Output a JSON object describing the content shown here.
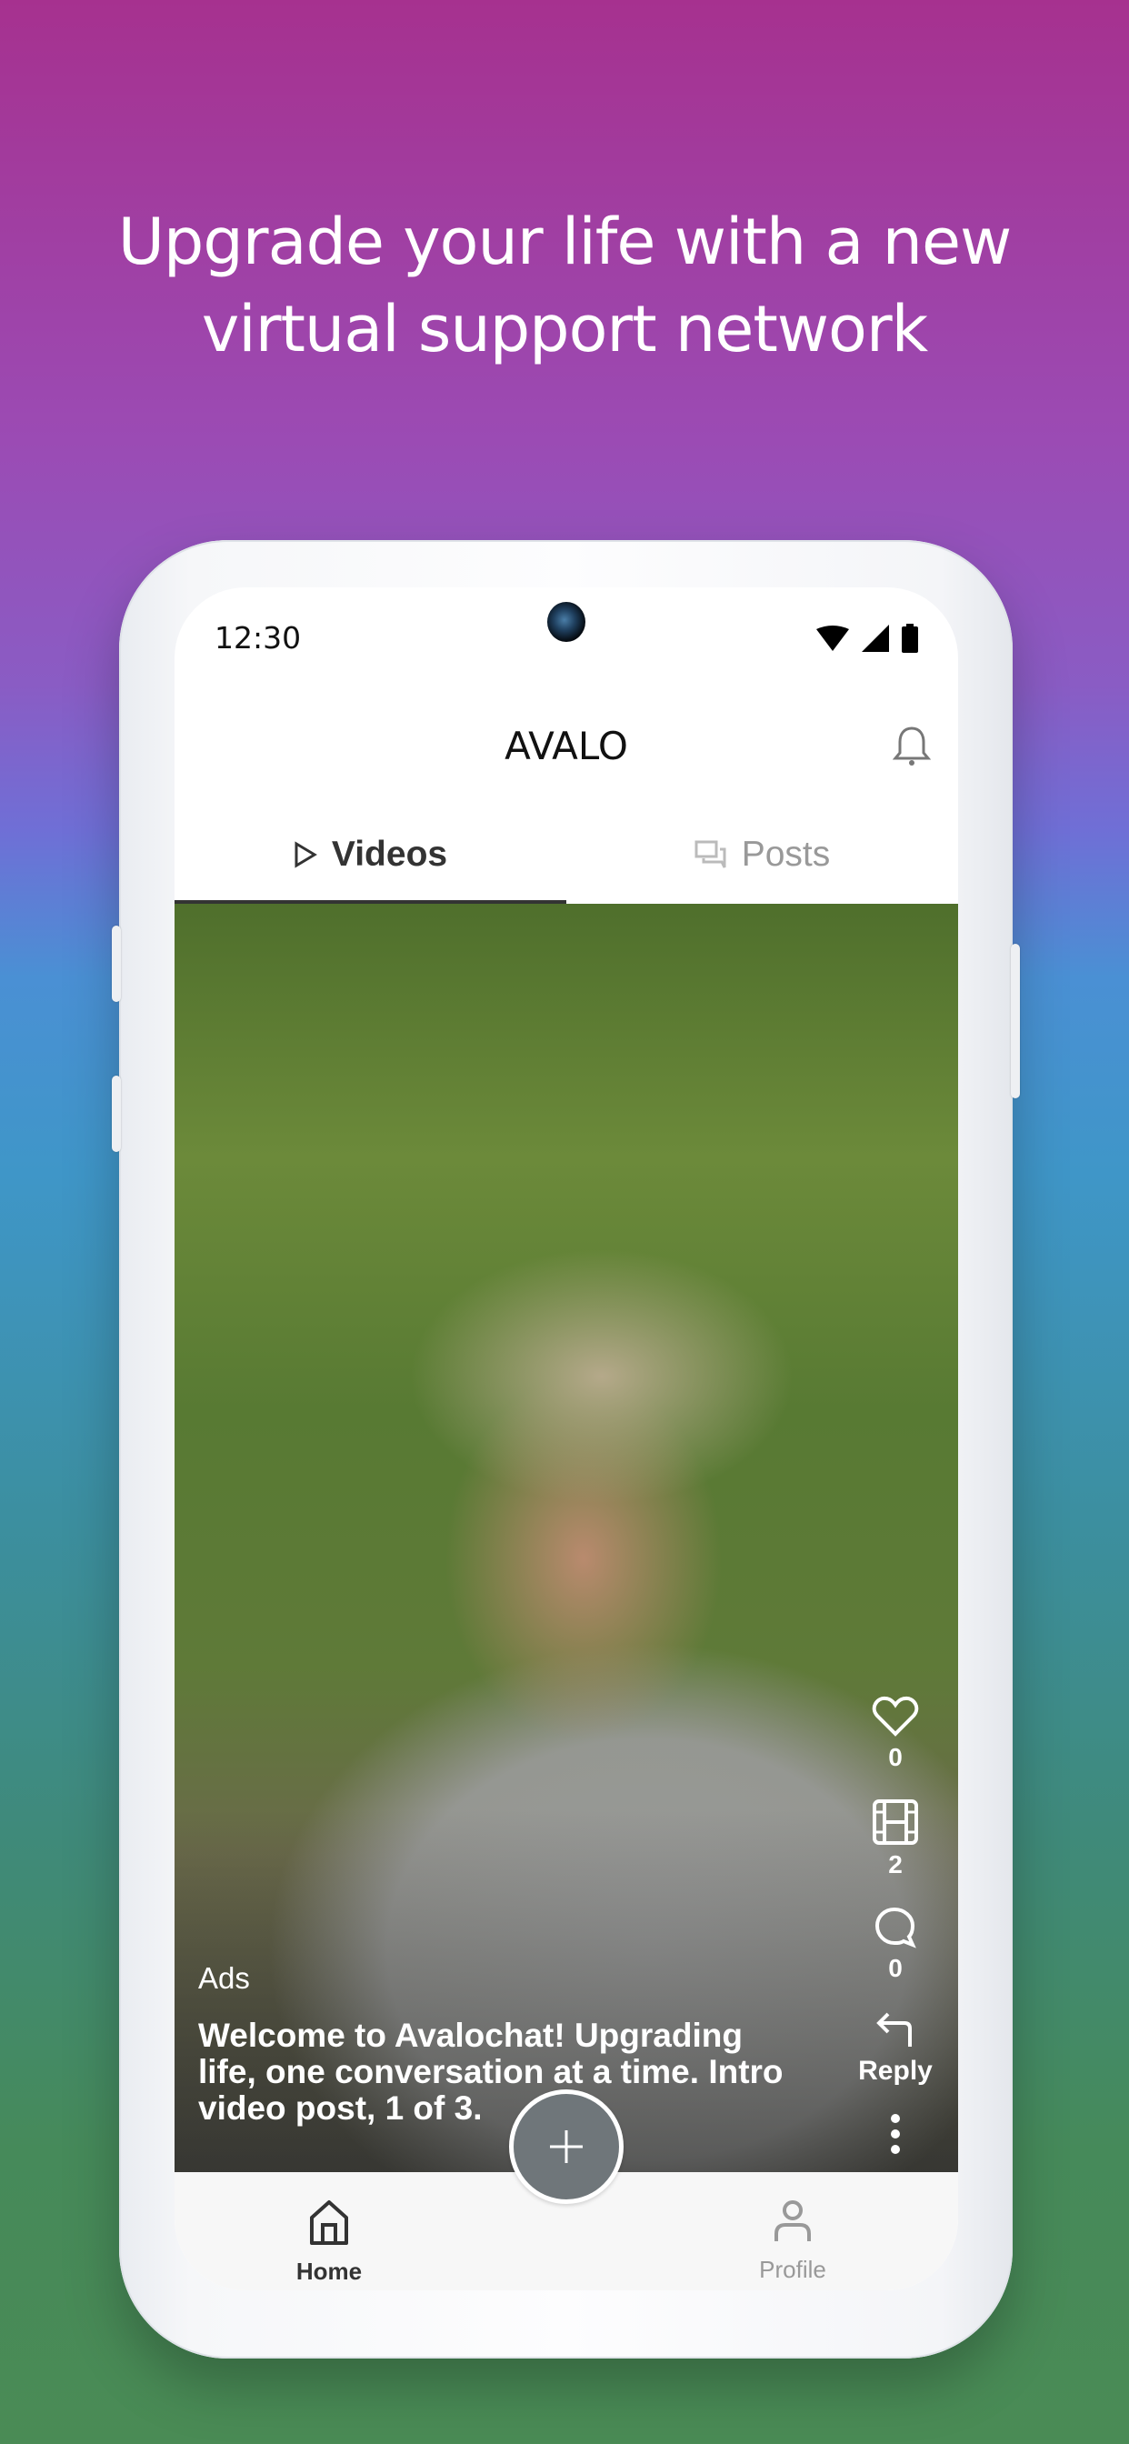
{
  "promo": {
    "headline_line1": "Upgrade your life with a new",
    "headline_line2": "virtual support network"
  },
  "status_bar": {
    "time": "12:30",
    "icons": [
      "wifi-icon",
      "signal-icon",
      "battery-icon"
    ]
  },
  "header": {
    "title": "AVALO",
    "notification_icon": "bell-icon"
  },
  "tabs": [
    {
      "label": "Videos",
      "icon": "play-icon",
      "active": true
    },
    {
      "label": "Posts",
      "icon": "chat-bubbles-icon",
      "active": false
    }
  ],
  "video": {
    "ads_label": "Ads",
    "caption": "Welcome to Avalochat! Upgrading life, one conversation at a time. Intro video post, 1 of 3.",
    "actions": {
      "likes": "0",
      "videos": "2",
      "comments": "0",
      "reply_label": "Reply"
    }
  },
  "bottom_nav": {
    "home_label": "Home",
    "profile_label": "Profile",
    "add_icon": "plus-icon"
  },
  "colors": {
    "gradient_top": "#a6318f",
    "gradient_mid": "#4a90d4",
    "gradient_bottom": "#4a8b55",
    "fab": "#6f767a",
    "tab_active": "#333333",
    "tab_inactive": "#999999"
  }
}
